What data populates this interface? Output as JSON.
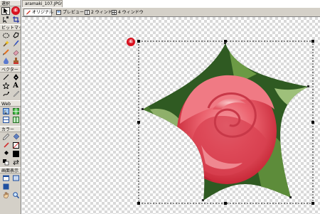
{
  "document": {
    "tab_title": "aramaki_107.JPG*"
  },
  "view_tabs": [
    {
      "label": "オリジナル",
      "icon": "pencil-icon",
      "active": true
    },
    {
      "label": "プレビュー",
      "icon": "preview-icon",
      "active": false
    },
    {
      "label": "2 ウィンドウ",
      "icon": "two-window-icon",
      "active": false
    },
    {
      "label": "4 ウィンドウ",
      "icon": "four-window-icon",
      "active": false
    }
  ],
  "tools_panel": {
    "sections": [
      {
        "key": "select",
        "label": "選択"
      },
      {
        "key": "bitmap",
        "label": "ビットマップ"
      },
      {
        "key": "vector",
        "label": "ベクター"
      },
      {
        "key": "web",
        "label": "Web"
      },
      {
        "key": "color",
        "label": "カラー"
      },
      {
        "key": "view",
        "label": "画面表示"
      }
    ],
    "badge_label": "⑥"
  },
  "canvas": {
    "badge_label": "⑥",
    "selection": "star-shaped photo object with dashed bounding box and handles",
    "image_subject": "pink rose"
  },
  "colors": {
    "badge_red": "#d8101e",
    "panel_gray": "#d4d0c8",
    "checker_gray": "#d9d9d9",
    "rose_pink": "#e8505a"
  }
}
